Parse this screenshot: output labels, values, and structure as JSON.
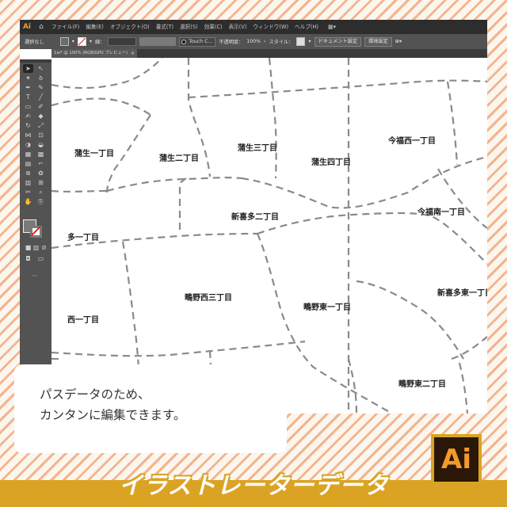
{
  "app": {
    "logo": "Ai",
    "menu": [
      "ファイル(F)",
      "編集(E)",
      "オブジェクト(O)",
      "書式(T)",
      "選択(S)",
      "効果(C)",
      "表示(V)",
      "ウィンドウ(W)",
      "ヘルプ(H)"
    ],
    "workspace_icon": "grid-icon"
  },
  "control_bar": {
    "selection": "選択なし",
    "stroke_label": "線：",
    "brush": "Touch C...",
    "opacity_label": "不透明度：",
    "opacity_value": "100%",
    "style_label": "スタイル：",
    "doc_settings_button": "ドキュメント設定",
    "preferences_button": "環境設定"
  },
  "document_tab": {
    "title": "1ai* @ 100% (RGB/GPU プレビュー)",
    "close": "×"
  },
  "map": {
    "areas": [
      "蒲生一丁目",
      "蒲生二丁目",
      "蒲生三丁目",
      "蒲生四丁目",
      "今福西一丁目",
      "新喜多二丁目",
      "今福南一丁目",
      "多一丁目",
      "鴫野西三丁目",
      "鴫野東一丁目",
      "新喜多東一丁目",
      "西一丁目",
      "鴫野東二丁目"
    ]
  },
  "note": {
    "line1": "パスデータのため、",
    "line2": "カンタンに編集できます。"
  },
  "banner": {
    "title": "イラストレーターデータ",
    "badge": "Ai"
  },
  "colors": {
    "background_stripe": "#f4b48e",
    "banner": "#dba323",
    "ai_badge_bg": "#2b1708",
    "ai_badge_text": "#f29b2b",
    "road_line": "#8a8a8a"
  }
}
